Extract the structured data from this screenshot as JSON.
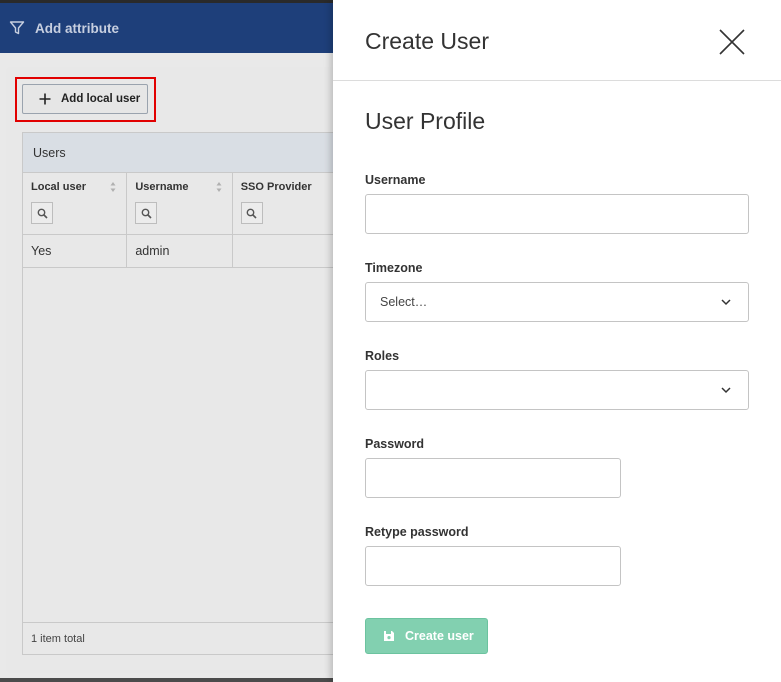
{
  "background": {
    "topbar": {
      "add_attribute_label": "Add attribute",
      "icon": "funnel-icon"
    },
    "toolbar": {
      "add_local_user_label": "Add local user",
      "icon": "plus-icon"
    },
    "users_table": {
      "title": "Users",
      "columns": [
        "Local user",
        "Username",
        "SSO Provider"
      ],
      "rows": [
        [
          "Yes",
          "admin",
          ""
        ]
      ],
      "footer": "1 item total"
    }
  },
  "drawer": {
    "title": "Create User",
    "section_title": "User Profile",
    "fields": {
      "username": {
        "label": "Username",
        "value": ""
      },
      "timezone": {
        "label": "Timezone",
        "value": "Select…"
      },
      "roles": {
        "label": "Roles",
        "value": ""
      },
      "password": {
        "label": "Password",
        "value": ""
      },
      "retype_password": {
        "label": "Retype password",
        "value": ""
      }
    },
    "submit_label": "Create user"
  },
  "colors": {
    "topbar": "#1e3f7a",
    "submit_button": "#82d0b0",
    "highlight": "#e10000"
  }
}
